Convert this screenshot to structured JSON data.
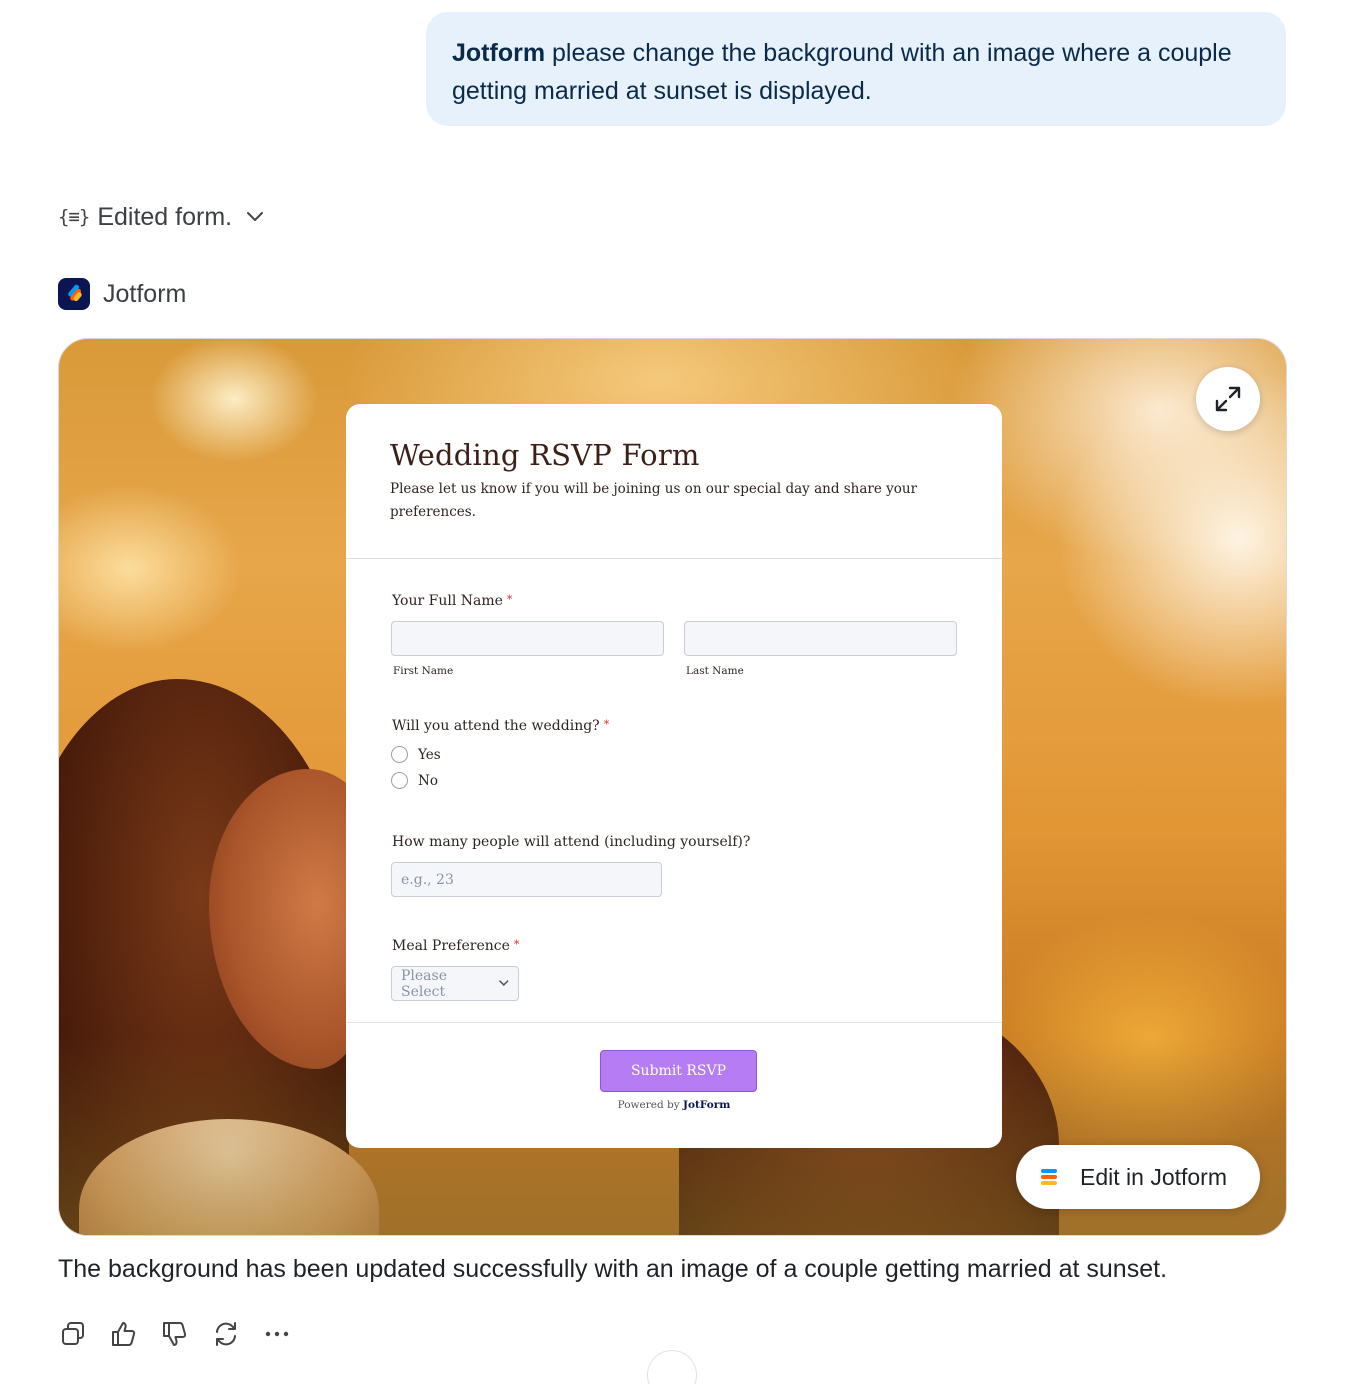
{
  "user_message": {
    "bold": "Jotform",
    "text": " please change the background with an image where a couple getting married at sunset is displayed."
  },
  "tool_call": {
    "icon": "braces-icon",
    "label": "Edited form.",
    "toggle_icon": "chevron-down-icon"
  },
  "app": {
    "name": "Jotform",
    "logo_icon": "jotform-logo-icon"
  },
  "preview": {
    "background": "couple getting married at sunset",
    "expand_icon": "expand-icon",
    "edit_button": "Edit in Jotform",
    "form": {
      "title": "Wedding RSVP Form",
      "description": "Please let us know if you will be joining us on our special day and share your preferences.",
      "full_name": {
        "label": "Your Full Name",
        "required_mark": "*",
        "first_value": "",
        "first_sublabel": "First Name",
        "last_value": "",
        "last_sublabel": "Last Name"
      },
      "attend": {
        "label": "Will you attend the wedding?",
        "required_mark": "*",
        "options": [
          "Yes",
          "No"
        ]
      },
      "people": {
        "label": "How many people will attend (including yourself)?",
        "placeholder": "e.g., 23",
        "value": ""
      },
      "meal": {
        "label": "Meal Preference",
        "required_mark": "*",
        "selected": "Please Select"
      },
      "submit_label": "Submit RSVP",
      "powered_prefix": "Powered by",
      "powered_brand": "JotForm"
    }
  },
  "assistant_message": "The background has been updated successfully with an image of a couple getting married at sunset.",
  "actions": [
    "copy-icon",
    "thumbs-up-icon",
    "thumbs-down-icon",
    "regenerate-icon",
    "more-icon"
  ],
  "colors": {
    "user_bubble": "#e6f1fb",
    "submit_button": "#b57cf3",
    "required": "#e0302a",
    "jotform_navy": "#0a1551"
  }
}
